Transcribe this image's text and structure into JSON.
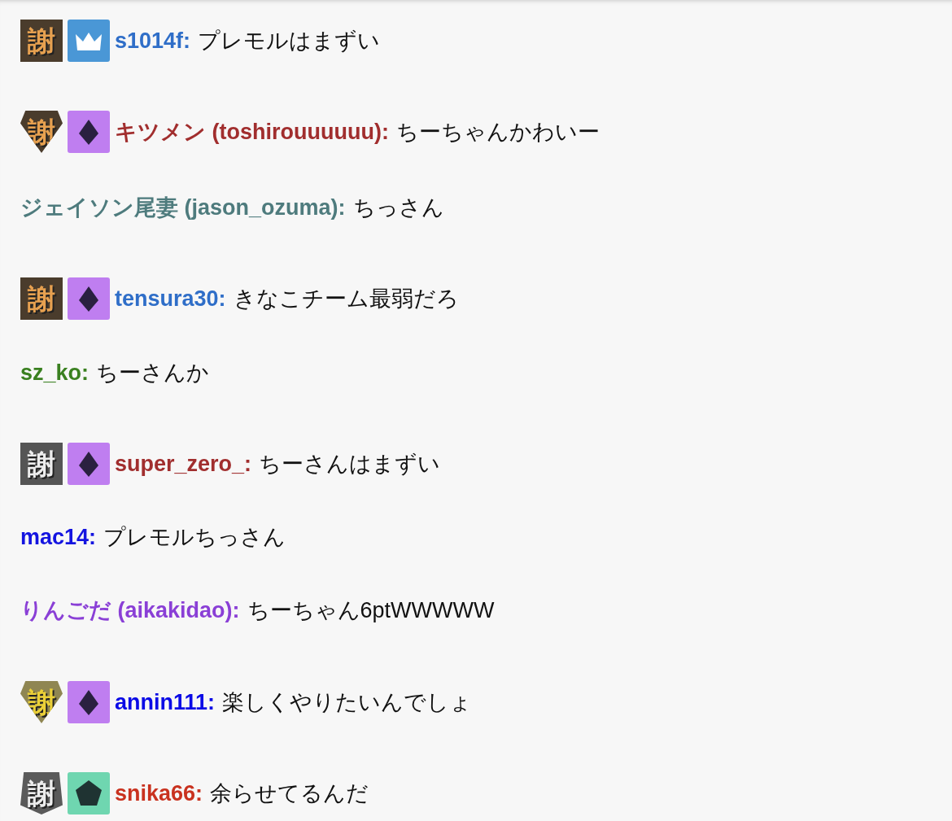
{
  "messages": [
    {
      "badges": [
        {
          "kind": "square",
          "glyph": "謝",
          "color": "#4a3c2c"
        },
        {
          "kind": "crown",
          "color": "#4a97d6"
        }
      ],
      "name": "s1014f:",
      "color": "#2f6ec8",
      "text": "プレモルはまずい"
    },
    {
      "badges": [
        {
          "kind": "gem",
          "glyph": "謝",
          "color": "#4a3c2c"
        },
        {
          "kind": "diamond",
          "color": "#bf7ef0"
        }
      ],
      "name": "キツメン (toshirouuuuuu):",
      "color": "#a12e2e",
      "text": "ちーちゃんかわいー"
    },
    {
      "name": "ジェイソン尾妻 (jason_ozuma):",
      "color": "#4e7b7d",
      "text": "ちっさん"
    },
    {
      "badges": [
        {
          "kind": "square",
          "glyph": "謝",
          "color": "#4a3c2c"
        },
        {
          "kind": "diamond",
          "color": "#bf7ef0"
        }
      ],
      "name": "tensura30:",
      "color": "#2f6ec8",
      "text": "きなこチーム最弱だろ"
    },
    {
      "name": "sz_ko:",
      "color": "#3a8020",
      "text": "ちーさんか"
    },
    {
      "badges": [
        {
          "kind": "square",
          "glyph": "謝",
          "color": "#555555"
        },
        {
          "kind": "diamond",
          "color": "#bf7ef0"
        }
      ],
      "name": "super_zero_:",
      "color": "#a12e2e",
      "text": "ちーさんはまずい"
    },
    {
      "name": "mac14:",
      "color": "#1414e0",
      "text": "プレモルちっさん"
    },
    {
      "name": "りんごだ (aikakidao):",
      "color": "#8a3fd6",
      "text": "ちーちゃん6ptWWWWW"
    },
    {
      "badges": [
        {
          "kind": "gem",
          "glyph": "謝",
          "color": "#8f8652"
        },
        {
          "kind": "diamond",
          "color": "#bf7ef0"
        }
      ],
      "name": "annin111:",
      "color": "#0a0ae6",
      "text": "楽しくやりたいんでしょ"
    },
    {
      "badges": [
        {
          "kind": "shield",
          "glyph": "謝",
          "color": "#5a5a5a"
        },
        {
          "kind": "pentagon",
          "color": "#6fd6b0"
        }
      ],
      "name": "snika66:",
      "color": "#c9321f",
      "text": "余らせてるんだ"
    }
  ]
}
